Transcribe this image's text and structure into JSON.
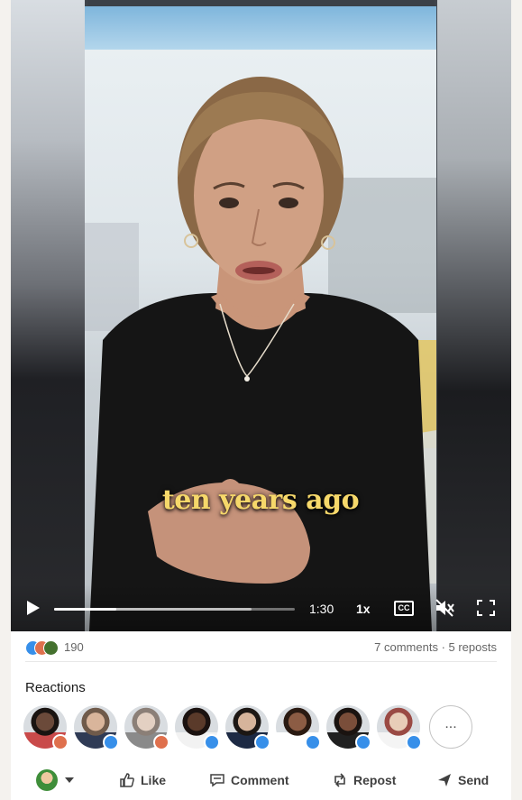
{
  "video": {
    "caption": "ten years ago",
    "time": "1:30",
    "speed": "1x",
    "cc_label": "CC",
    "progress_fraction": 0.26,
    "buffered_fraction": 0.82
  },
  "stats": {
    "reaction_count": "190",
    "comments": "7 comments",
    "separator": " · ",
    "reposts": "5 reposts"
  },
  "reactions": {
    "title": "Reactions",
    "more_label": "...",
    "people": [
      {
        "badge": "heart",
        "skin": "#6b4a3a",
        "hair": "#1a1411",
        "shirt": "#c94a4a"
      },
      {
        "badge": "like",
        "skin": "#d9b59b",
        "hair": "#6f5a4a",
        "shirt": "#2f3b55"
      },
      {
        "badge": "heart",
        "skin": "#e3d0c2",
        "hair": "#8b7f77",
        "shirt": "#8a8a8a"
      },
      {
        "badge": "like",
        "skin": "#5a3a2a",
        "hair": "#1b1210",
        "shirt": "#f2f2f2"
      },
      {
        "badge": "like",
        "skin": "#d6b49b",
        "hair": "#1c1714",
        "shirt": "#1d2a44"
      },
      {
        "badge": "like",
        "skin": "#8c5c44",
        "hair": "#2a1a12",
        "shirt": "#ffffff"
      },
      {
        "badge": "like",
        "skin": "#7a4e3a",
        "hair": "#1a1310",
        "shirt": "#202020"
      },
      {
        "badge": "like",
        "skin": "#e8cdb8",
        "hair": "#9a4a44",
        "shirt": "#f4f4f4"
      }
    ]
  },
  "colors": {
    "like_badge": "#378fe9",
    "heart_badge": "#df704d",
    "caption": "#f6d86a"
  },
  "actions": {
    "like": "Like",
    "comment": "Comment",
    "repost": "Repost",
    "send": "Send"
  }
}
